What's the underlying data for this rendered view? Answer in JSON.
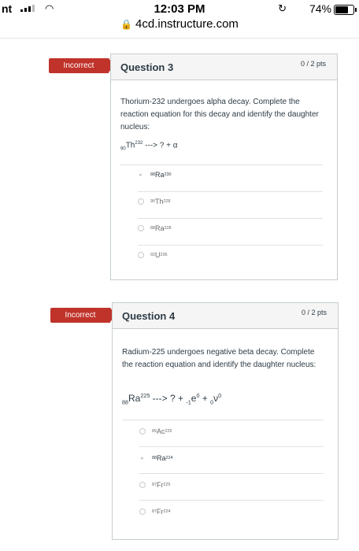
{
  "statusbar": {
    "carrier": "nt",
    "time": "12:03 PM",
    "battery": "74%"
  },
  "browser": {
    "url": "4cd.instructure.com"
  },
  "questions": [
    {
      "badge": "Incorrect",
      "title": "Question 3",
      "points": "0 / 2 pts",
      "text": "Thorium-232 undergoes alpha decay. Complete the reaction equation for this decay and identify the daughter nucleus:",
      "equation": {
        "sub": "90",
        "symbol": "Th",
        "sup": "232",
        "rest": " ---> ? + α"
      },
      "options": [
        {
          "sub": "88",
          "symbol": "Ra",
          "sup": "230",
          "selected": true
        },
        {
          "sub": "90",
          "symbol": "Th",
          "sup": "228",
          "selected": false
        },
        {
          "sub": "88",
          "symbol": "Ra",
          "sup": "228",
          "selected": false
        },
        {
          "sub": "92",
          "symbol": "U",
          "sup": "236",
          "selected": false
        }
      ]
    },
    {
      "badge": "Incorrect",
      "title": "Question 4",
      "points": "0 / 2 pts",
      "text": "Radium-225 undergoes negative beta decay. Complete the reaction equation and identify the daughter nucleus:",
      "equation": {
        "sub": "88",
        "symbol": "Ra",
        "sup": "225",
        "rest": " ---> ? + ",
        "e_sub": "-1",
        "e": "e",
        "e_sup": "0",
        "plus": " + ",
        "nu_sub": "0",
        "nu": "ν",
        "nu_sup": "0"
      },
      "options": [
        {
          "sub": "89",
          "symbol": "Ac",
          "sup": "225",
          "selected": false
        },
        {
          "sub": "88",
          "symbol": "Ra",
          "sup": "224",
          "selected": true
        },
        {
          "sub": "87",
          "symbol": "Fr",
          "sup": "225",
          "selected": false
        },
        {
          "sub": "87",
          "symbol": "Fr",
          "sup": "224",
          "selected": false
        }
      ]
    }
  ]
}
